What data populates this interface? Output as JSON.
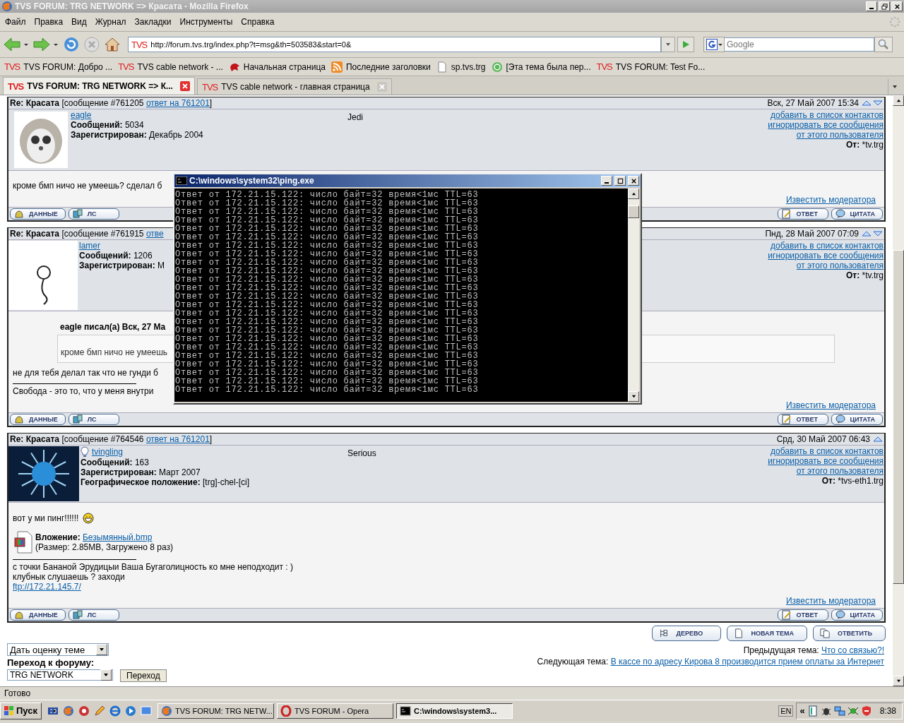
{
  "window": {
    "title": "TVS FORUM: TRG NETWORK => Красата - Mozilla Firefox"
  },
  "menu": [
    "Файл",
    "Правка",
    "Вид",
    "Журнал",
    "Закладки",
    "Инструменты",
    "Справка"
  ],
  "address": {
    "mark": "TVS",
    "value": "http://forum.tvs.trg/index.php?t=msg&th=503583&start=0&"
  },
  "search": {
    "placeholder": "Google"
  },
  "bookmarks": [
    {
      "kind": "tvs",
      "mark": "TVS",
      "label": "TVS FORUM: Добро ..."
    },
    {
      "kind": "tvs",
      "mark": "TVS",
      "label": "TVS cable network - ..."
    },
    {
      "kind": "creature",
      "label": "Начальная страница"
    },
    {
      "kind": "rss",
      "label": "Последние заголовки"
    },
    {
      "kind": "page",
      "label": "sp.tvs.trg"
    },
    {
      "kind": "recycle",
      "label": "[Эта тема была пер..."
    },
    {
      "kind": "tvs",
      "mark": "TVS",
      "label": "TVS FORUM: Test Fo..."
    }
  ],
  "tabs": [
    {
      "mark": "TVS",
      "label": "TVS FORUM: TRG NETWORK => К...",
      "selected": true
    },
    {
      "mark": "TVS",
      "label": "TVS cable network - главная страница",
      "selected": false
    }
  ],
  "posts": [
    {
      "subject": "Re: Красата",
      "number": "[сообщение #761205",
      "reply_link": "ответ на 761201",
      "close": "]",
      "date": "Вск, 27 Май 2007 15:34",
      "next_arrow": true,
      "avatar": {
        "kind": "hedgehog"
      },
      "online_icon": false,
      "user": "eagle",
      "rank": "Jedi",
      "stats": [
        {
          "label": "Сообщений:",
          "value": "5034"
        },
        {
          "label": "Зарегистрирован:",
          "value": "Декабрь 2004"
        }
      ],
      "actions": [
        "добавить в список контактов",
        "игнорировать все сообщения",
        "от этого пользователя"
      ],
      "from": {
        "label": "От:",
        "value": "*tv.trg"
      },
      "body": [
        {
          "kind": "text",
          "text": "кроме бмп ничо не умеешь? сделал б",
          "smiley": false
        }
      ],
      "report": "Известить модератора",
      "left_buttons": [
        "ДАННЫЕ",
        "ЛС"
      ],
      "right_buttons": [
        "ОТВЕТ",
        "ЦИТАТА"
      ]
    },
    {
      "subject": "Re: Красата",
      "number": "[сообщение #761915",
      "reply_link": "отве",
      "date": "Пнд, 28 Май 2007 07:09",
      "next_arrow": true,
      "avatar": {
        "kind": "figure"
      },
      "online_icon": false,
      "user": "lamer",
      "stats": [
        {
          "label": "Сообщений:",
          "value": "1206"
        },
        {
          "label": "Зарегистрирован:",
          "value": "М"
        }
      ],
      "actions": [
        "добавить в список контактов",
        "игнорировать все сообщения",
        "от этого пользователя"
      ],
      "from": {
        "label": "От:",
        "value": "*tv.trg"
      },
      "body": [
        {
          "kind": "quote",
          "header": "eagle писал(а) Вск, 27 Ма",
          "text": "кроме бмп ничо не умеешь"
        },
        {
          "kind": "text",
          "text": "не для тебя делал так что не гунди б",
          "smiley": false
        },
        {
          "kind": "signature",
          "lines": [
            {
              "kind": "text",
              "text": "Свобода - это то, что у меня внутри"
            }
          ]
        }
      ],
      "report": "Известить модератора",
      "left_buttons": [
        "ДАННЫЕ",
        "ЛС"
      ],
      "right_buttons": [
        "ОТВЕТ",
        "ЦИТАТА"
      ]
    },
    {
      "subject": "Re: Красата",
      "number": "[сообщение #764546",
      "reply_link": "ответ на 761201",
      "close": "]",
      "date": "Срд, 30 Май 2007 06:43",
      "next_arrow": false,
      "avatar": {
        "kind": "spiky"
      },
      "online_icon": true,
      "user": "tvingling",
      "rank": "Serious",
      "stats": [
        {
          "label": "Сообщений:",
          "value": "163"
        },
        {
          "label": "Зарегистрирован:",
          "value": "Март 2007"
        },
        {
          "label": "Географическое положение:",
          "value": "[trg]-chel-[ci]"
        }
      ],
      "actions": [
        "добавить в список контактов",
        "игнорировать все сообщения",
        "от этого пользователя"
      ],
      "from": {
        "label": "От:",
        "value": "*tvs-eth1.trg"
      },
      "body": [
        {
          "kind": "text",
          "text": "вот у ми пинг!!!!!!",
          "smiley": true
        },
        {
          "kind": "attachment",
          "label": "Вложение:",
          "link": "Безымянный.bmp",
          "info": "(Размер: 2.85MB, Загружено 8 раз)"
        },
        {
          "kind": "signature",
          "lines": [
            {
              "kind": "text",
              "text": "с точки Бананой Эрудицыи Ваша Бугаголицность ко мне неподходит : )"
            },
            {
              "kind": "text",
              "text": "клубнык слушаешь ? заходи"
            },
            {
              "kind": "link",
              "text": "ftp://172.21.145.7/"
            }
          ]
        }
      ],
      "report": "Известить модератора",
      "left_buttons": [
        "ДАННЫЕ",
        "ЛС"
      ],
      "right_buttons": [
        "ОТВЕТ",
        "ЦИТАТА"
      ]
    }
  ],
  "topic_buttons": [
    "ДЕРЕВО",
    "НОВАЯ ТЕМА",
    "ОТВЕТИТЬ"
  ],
  "footer": {
    "rate_select": "Дать оценку теме",
    "jump_label": "Переход к форуму:",
    "forum_select": "TRG NETWORK",
    "jump_button": "Переход",
    "prev": {
      "label": "Предыдущая тема:",
      "link": "Что со связью?!"
    },
    "next": {
      "label": "Следующая тема:",
      "link": "В кассе по адресу Кирова 8 производится прием оплаты за Интернет"
    }
  },
  "status_bar": "Готово",
  "taskbar": {
    "start": "Пуск",
    "tasks": [
      {
        "kind": "firefox",
        "label": "TVS FORUM: TRG NETW...",
        "selected": false
      },
      {
        "kind": "opera",
        "label": "TVS FORUM - Opera",
        "selected": false
      },
      {
        "kind": "console",
        "label": "C:\\windows\\system3...",
        "selected": true
      }
    ],
    "chevron": "«",
    "language": "EN",
    "clock": "8:38"
  },
  "console": {
    "title": "C:\\windows\\system32\\ping.exe",
    "lines": [
      "Ответ от 172.21.15.122: число байт=32 время<1мс TTL=63",
      "Ответ от 172.21.15.122: число байт=32 время<1мс TTL=63",
      "Ответ от 172.21.15.122: число байт=32 время<1мс TTL=63",
      "Ответ от 172.21.15.122: число байт=32 время<1мс TTL=63",
      "Ответ от 172.21.15.122: число байт=32 время<1мс TTL=63",
      "Ответ от 172.21.15.122: число байт=32 время<1мс TTL=63",
      "Ответ от 172.21.15.122: число байт=32 время<1мс TTL=63",
      "Ответ от 172.21.15.122: число байт=32 время<1мс TTL=63",
      "Ответ от 172.21.15.122: число байт=32 время<1мс TTL=63",
      "Ответ от 172.21.15.122: число байт=32 время<1мс TTL=63",
      "Ответ от 172.21.15.122: число байт=32 время<1мс TTL=63",
      "Ответ от 172.21.15.122: число байт=32 время<1мс TTL=63",
      "Ответ от 172.21.15.122: число байт=32 время<1мс TTL=63",
      "Ответ от 172.21.15.122: число байт=32 время<1мс TTL=63",
      "Ответ от 172.21.15.122: число байт=32 время<1мс TTL=63",
      "Ответ от 172.21.15.122: число байт=32 время<1мс TTL=63",
      "Ответ от 172.21.15.122: число байт=32 время<1мс TTL=63",
      "Ответ от 172.21.15.122: число байт=32 время<1мс TTL=63",
      "Ответ от 172.21.15.122: число байт=32 время<1мс TTL=63",
      "Ответ от 172.21.15.122: число байт=32 время<1мс TTL=63",
      "Ответ от 172.21.15.122: число байт=32 время<1мс TTL=63",
      "Ответ от 172.21.15.122: число байт=32 время<1мс TTL=63",
      "Ответ от 172.21.15.122: число байт=32 время<1мс TTL=63",
      "Ответ от 172.21.15.122: число байт=32 время<1мс TTL=63"
    ]
  }
}
